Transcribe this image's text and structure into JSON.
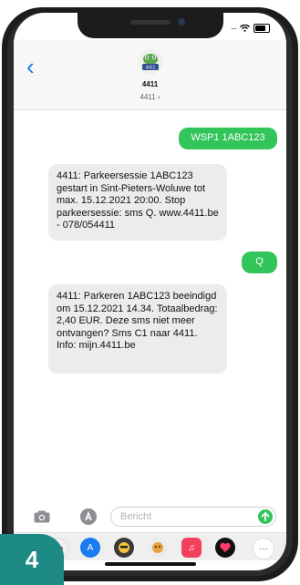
{
  "contact": {
    "name": "4411",
    "subtitle": "4411 ›",
    "avatar_text": "4411"
  },
  "messages": [
    {
      "direction": "out",
      "text": "WSP1 1ABC123"
    },
    {
      "direction": "in",
      "text": "4411: Parkeersessie 1ABC123 gestart in Sint-Pieters-Woluwe tot max. 15.12.2021 20:00. Stop parkeersessie: sms Q. www.4411.be - 078/054411"
    },
    {
      "direction": "out",
      "text": "Q"
    },
    {
      "direction": "in",
      "text": "4411: Parkeren 1ABC123 beeindigd om 15.12.2021 14.34. Totaalbedrag: 2,40 EUR. Deze sms niet meer ontvangen? Sms C1 naar 4411. Info: mijn.4411.be"
    }
  ],
  "input": {
    "placeholder": "Bericht",
    "send_icon": "arrow-up-icon"
  },
  "apps": [
    "photos-icon",
    "appstore-icon",
    "memoji-icon",
    "sticker-icon",
    "music-icon",
    "heart-icon",
    "more-icon"
  ],
  "step_badge": "4",
  "colors": {
    "accent_blue": "#1a7cf0",
    "sms_green": "#32c55a",
    "badge_teal": "#1e8a84",
    "incoming_gray": "#ececec"
  }
}
